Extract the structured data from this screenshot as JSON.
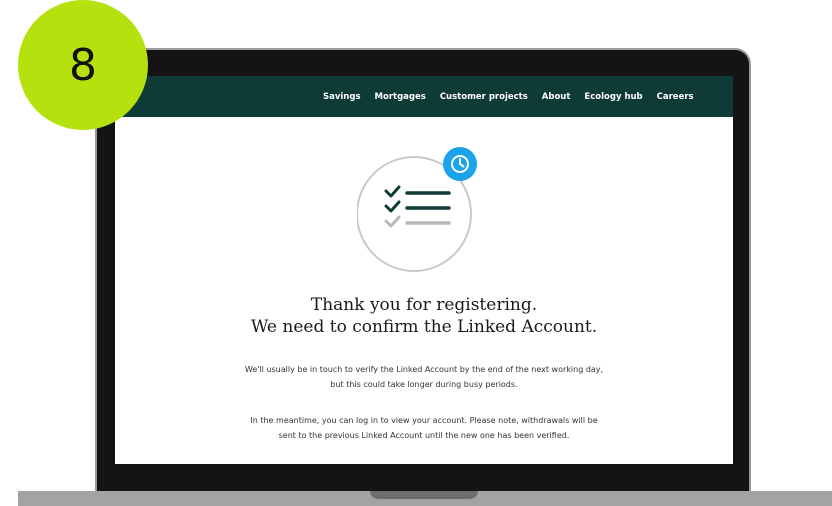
{
  "step": {
    "number": "8"
  },
  "nav": {
    "items": [
      {
        "label": "Savings"
      },
      {
        "label": "Mortgages"
      },
      {
        "label": "Customer projects"
      },
      {
        "label": "About"
      },
      {
        "label": "Ecology hub"
      },
      {
        "label": "Careers"
      }
    ]
  },
  "content": {
    "heading_line1": "Thank you for registering.",
    "heading_line2": "We need to confirm the Linked Account.",
    "para1_line1": "We'll usually be in touch to verify the Linked Account by the end of the next working day,",
    "para1_line2": "but this could take longer during busy periods.",
    "para2_line1": "In the meantime, you can log in to view your account. Please note, withdrawals will be",
    "para2_line2": "sent to the previous Linked Account until the new one has been verified."
  },
  "icons": {
    "illustration": "checklist-icon",
    "clock": "clock-icon"
  },
  "colors": {
    "badge": "#b5e20f",
    "nav_background": "#0e3b36",
    "clock_badge": "#1aa3e8",
    "checklist": "#0e3b36"
  }
}
